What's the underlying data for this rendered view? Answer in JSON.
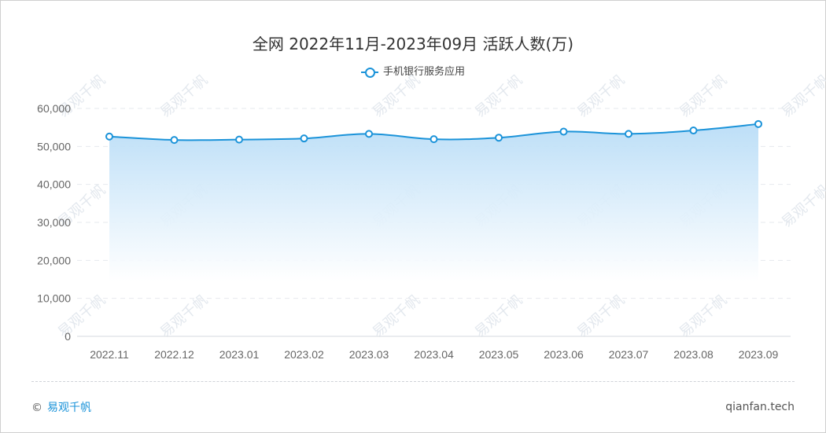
{
  "title": "全网 2022年11月-2023年09月 活跃人数(万)",
  "legend": {
    "label": "手机银行服务应用"
  },
  "footer": {
    "copyright": "©",
    "brand": "易观千帆",
    "site": "qianfan.tech"
  },
  "watermark": "易观千帆",
  "colors": {
    "line": "#1b93d9",
    "area_top": "#b9ddf7",
    "area_bottom": "#ffffff",
    "grid": "#e6e9ee"
  },
  "chart_data": {
    "type": "area",
    "title": "全网 2022年11月-2023年09月 活跃人数(万)",
    "xlabel": "",
    "ylabel": "",
    "categories": [
      "2022.11",
      "2022.12",
      "2023.01",
      "2023.02",
      "2023.03",
      "2023.04",
      "2023.05",
      "2023.06",
      "2023.07",
      "2023.08",
      "2023.09"
    ],
    "series": [
      {
        "name": "手机银行服务应用",
        "values": [
          52600,
          51700,
          51800,
          52100,
          53300,
          51900,
          52300,
          53900,
          53300,
          54200,
          55900
        ]
      }
    ],
    "yticks": [
      0,
      10000,
      20000,
      30000,
      40000,
      50000,
      60000
    ],
    "ytick_labels": [
      "0",
      "10,000",
      "20,000",
      "30,000",
      "40,000",
      "50,000",
      "60,000"
    ],
    "ylim": [
      0,
      60000
    ],
    "grid": true,
    "legend_position": "top-center"
  }
}
